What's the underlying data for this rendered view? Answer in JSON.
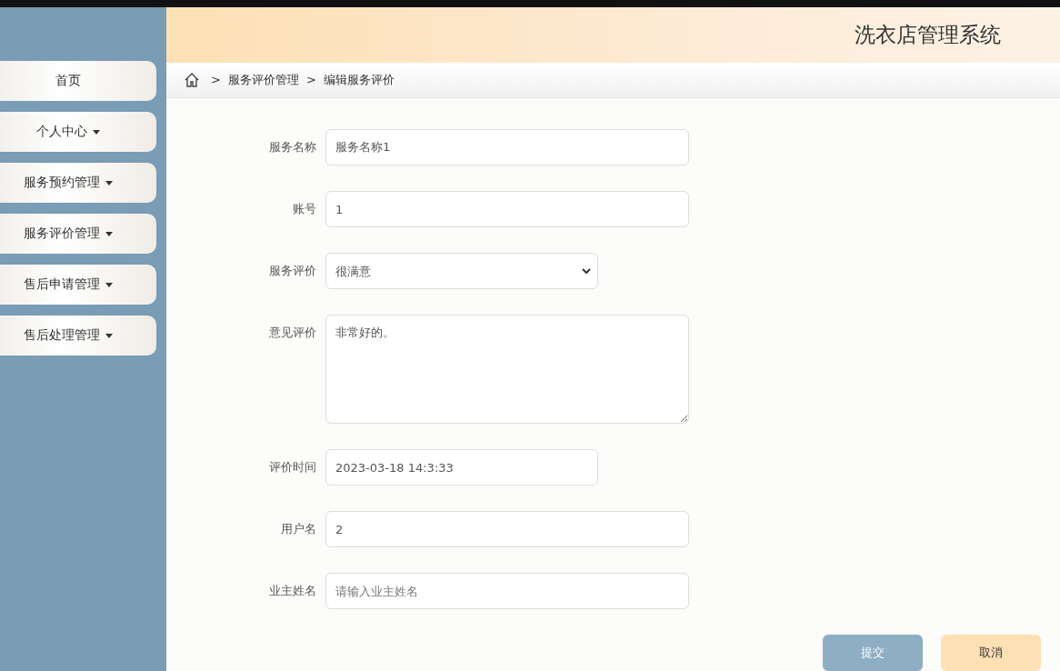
{
  "header": {
    "title": "洗衣店管理系统"
  },
  "sidebar": {
    "items": [
      {
        "label": "首页",
        "has_menu": false
      },
      {
        "label": "个人中心",
        "has_menu": true
      },
      {
        "label": "服务预约管理",
        "has_menu": true
      },
      {
        "label": "服务评价管理",
        "has_menu": true
      },
      {
        "label": "售后申请管理",
        "has_menu": true
      },
      {
        "label": "售后处理管理",
        "has_menu": true
      }
    ]
  },
  "breadcrumb": [
    {
      "separator": ">",
      "label": "服务评价管理"
    },
    {
      "separator": ">",
      "label": "编辑服务评价"
    }
  ],
  "form": {
    "fields": [
      {
        "label": "服务名称",
        "kind": "text",
        "value": "服务名称1"
      },
      {
        "label": "账号",
        "kind": "text",
        "value": "1"
      },
      {
        "label": "服务评价",
        "kind": "select",
        "value": "很满意"
      },
      {
        "label": "意见评价",
        "kind": "textarea",
        "value": "非常好的。"
      },
      {
        "label": "评价时间",
        "kind": "date",
        "value": "2023-03-18 14:3:33"
      },
      {
        "label": "用户名",
        "kind": "text",
        "value": "2"
      },
      {
        "label": "业主姓名",
        "kind": "text",
        "placeholder": "请输入业主姓名"
      }
    ]
  },
  "buttons": [
    {
      "label": "提交",
      "kind": "submit"
    },
    {
      "label": "取消",
      "kind": "cancel"
    }
  ]
}
